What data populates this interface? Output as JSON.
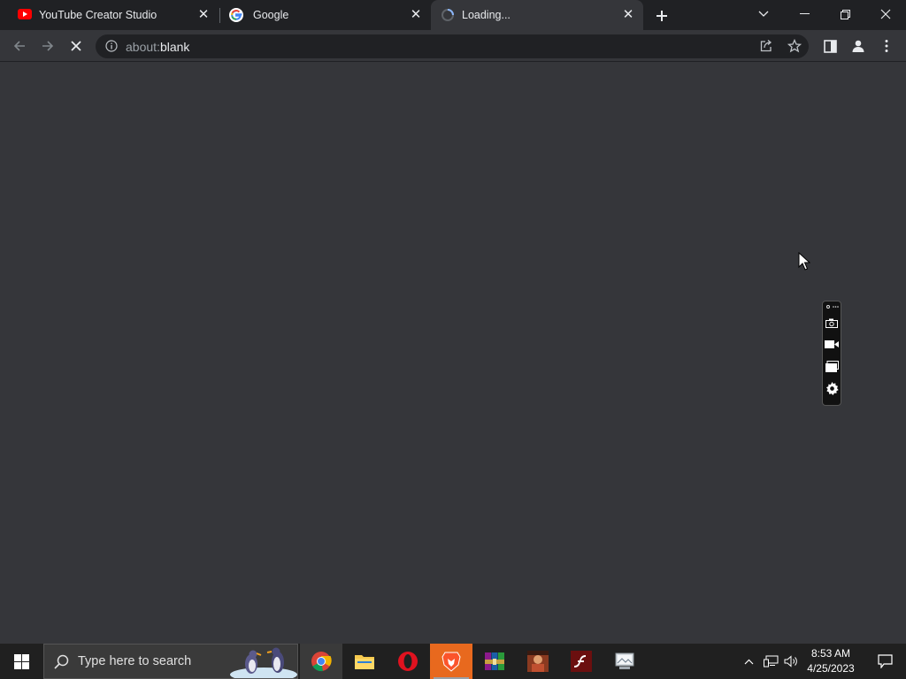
{
  "tabs": [
    {
      "label": "YouTube Creator Studio",
      "favicon": "youtube-icon",
      "active": false
    },
    {
      "label": "Google",
      "favicon": "google-icon",
      "active": false
    },
    {
      "label": "Loading...",
      "favicon": "loading-spinner-icon",
      "active": true
    }
  ],
  "omnibox": {
    "scheme": "about:",
    "host": "blank"
  },
  "taskbar": {
    "search_placeholder": "Type here to search",
    "time": "8:53 AM",
    "date": "4/25/2023"
  },
  "colors": {
    "accent": "#8ab4f8",
    "chrome_bg": "#202124",
    "content_bg": "#35363a",
    "taskbar_bg": "#202020"
  }
}
